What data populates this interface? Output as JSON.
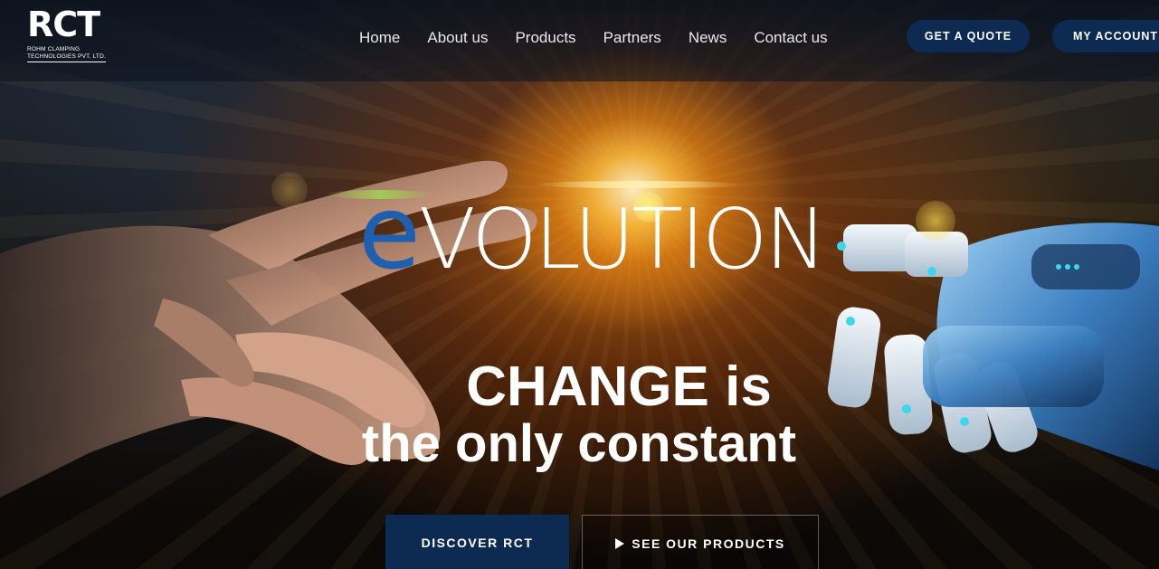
{
  "header": {
    "logo": {
      "mark": "RCT",
      "line1": "ROHM CLAMPING",
      "line2": "TECHNOLOGIES PVT. LTD."
    },
    "nav": [
      {
        "label": "Home"
      },
      {
        "label": "About us"
      },
      {
        "label": "Products"
      },
      {
        "label": "Partners"
      },
      {
        "label": "News"
      },
      {
        "label": "Contact us"
      }
    ],
    "quote_button": "GET A QUOTE",
    "account_button": "MY ACCOUNT"
  },
  "hero": {
    "headline_e": "e",
    "headline_rest": "VOLUTION",
    "tagline_line1": "CHANGE is",
    "tagline_line2": "the only constant",
    "discover_button": "DISCOVER RCT",
    "products_button": "SEE OUR PRODUCTS"
  },
  "colors": {
    "brand_navy": "#0d2b52",
    "evolution_e_blue": "#1f5fb0",
    "text_white": "#ffffff"
  },
  "icons": {
    "products_button_icon": "play-icon"
  }
}
